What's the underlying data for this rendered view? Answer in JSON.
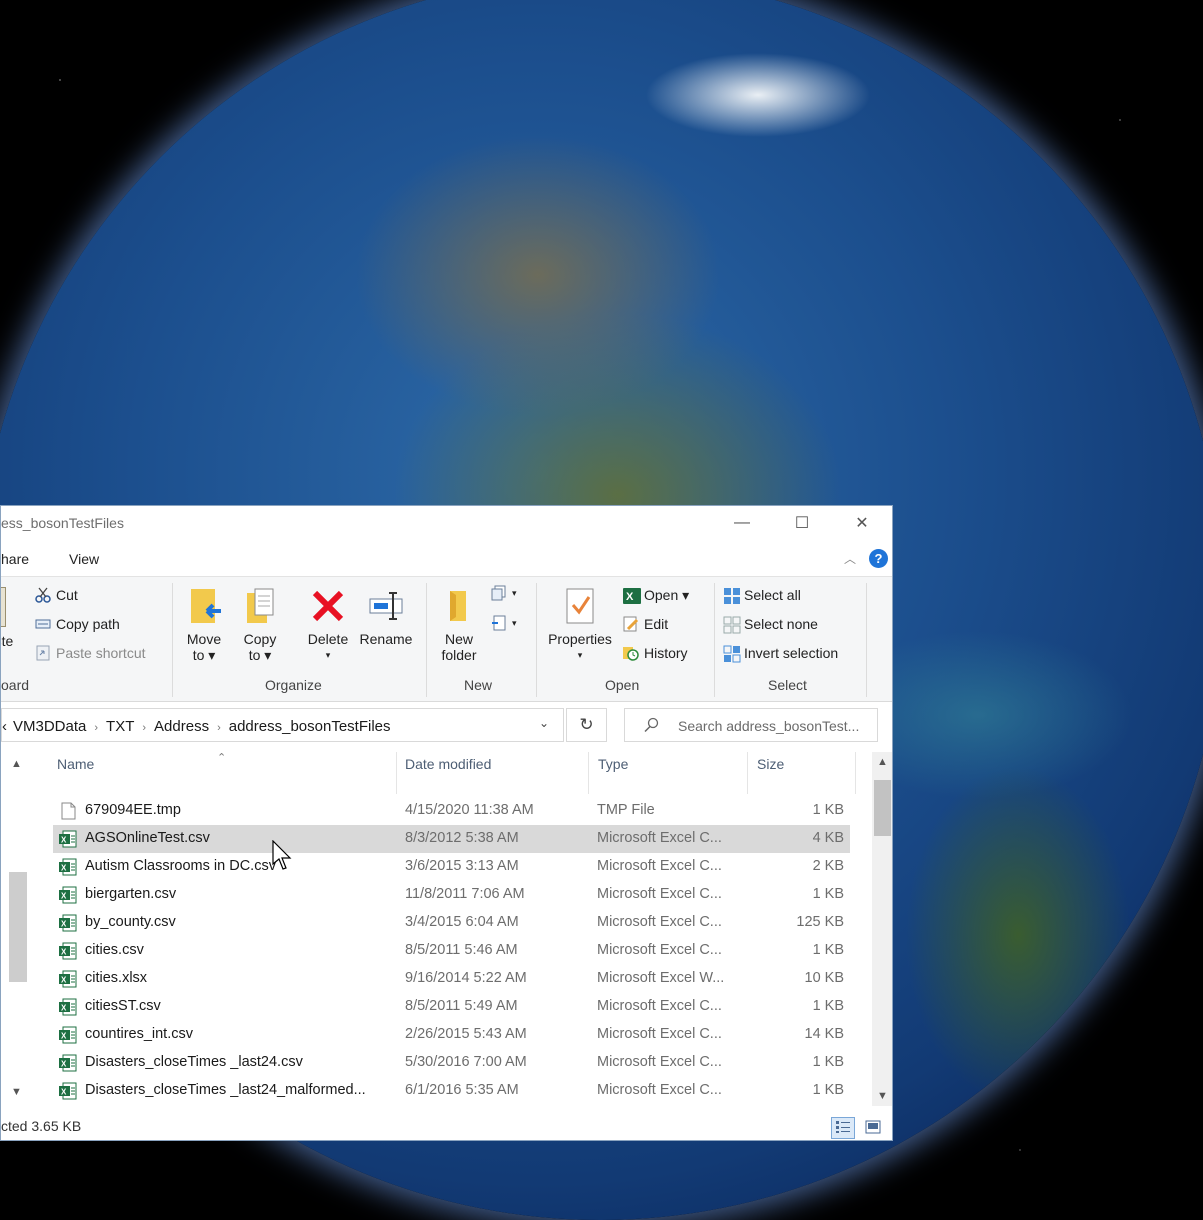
{
  "window": {
    "title": "ess_bosonTestFiles",
    "controls": {
      "minimize": "—",
      "maximize": "☐",
      "close": "✕"
    }
  },
  "menu": {
    "tab_share": "hare",
    "tab_view": "View",
    "help": "?"
  },
  "ribbon": {
    "clipboard": {
      "paste_label": "ste",
      "cut": "Cut",
      "copy_path": "Copy path",
      "paste_shortcut": "Paste shortcut",
      "group_label": "oard"
    },
    "organize": {
      "move_to_1": "Move",
      "move_to_2": "to ▾",
      "copy_to_1": "Copy",
      "copy_to_2": "to ▾",
      "delete": "Delete",
      "delete_arrow": "▾",
      "rename": "Rename",
      "group_label": "Organize"
    },
    "new": {
      "new_folder_1": "New",
      "new_folder_2": "folder",
      "group_label": "New"
    },
    "open": {
      "properties": "Properties",
      "properties_arrow": "▾",
      "open": "Open ▾",
      "edit": "Edit",
      "history": "History",
      "group_label": "Open"
    },
    "select": {
      "select_all": "Select all",
      "select_none": "Select none",
      "invert_selection": "Invert selection",
      "group_label": "Select"
    }
  },
  "address": {
    "crumb_0": "VM3DData",
    "crumb_1": "TXT",
    "crumb_2": "Address",
    "crumb_3": "address_bosonTestFiles",
    "lead": "‹"
  },
  "search": {
    "placeholder": "Search address_bosonTest..."
  },
  "columns": {
    "name": "Name",
    "date": "Date modified",
    "type": "Type",
    "size": "Size"
  },
  "files": [
    {
      "name": "679094EE.tmp",
      "date": "4/15/2020 11:38 AM",
      "type": "TMP File",
      "size": "1 KB",
      "icon": "file-icon"
    },
    {
      "name": "AGSOnlineTest.csv",
      "date": "8/3/2012 5:38 AM",
      "type": "Microsoft Excel C...",
      "size": "4 KB",
      "icon": "excel-icon",
      "selected": true
    },
    {
      "name": "Autism Classrooms in DC.csv",
      "date": "3/6/2015 3:13 AM",
      "type": "Microsoft Excel C...",
      "size": "2 KB",
      "icon": "excel-icon"
    },
    {
      "name": "biergarten.csv",
      "date": "11/8/2011 7:06 AM",
      "type": "Microsoft Excel C...",
      "size": "1 KB",
      "icon": "excel-icon"
    },
    {
      "name": "by_county.csv",
      "date": "3/4/2015 6:04 AM",
      "type": "Microsoft Excel C...",
      "size": "125 KB",
      "icon": "excel-icon"
    },
    {
      "name": "cities.csv",
      "date": "8/5/2011 5:46 AM",
      "type": "Microsoft Excel C...",
      "size": "1 KB",
      "icon": "excel-icon"
    },
    {
      "name": "cities.xlsx",
      "date": "9/16/2014 5:22 AM",
      "type": "Microsoft Excel W...",
      "size": "10 KB",
      "icon": "excel-icon"
    },
    {
      "name": "citiesST.csv",
      "date": "8/5/2011 5:49 AM",
      "type": "Microsoft Excel C...",
      "size": "1 KB",
      "icon": "excel-icon"
    },
    {
      "name": "countires_int.csv",
      "date": "2/26/2015 5:43 AM",
      "type": "Microsoft Excel C...",
      "size": "14 KB",
      "icon": "excel-icon"
    },
    {
      "name": "Disasters_closeTimes _last24.csv",
      "date": "5/30/2016 7:00 AM",
      "type": "Microsoft Excel C...",
      "size": "1 KB",
      "icon": "excel-icon"
    },
    {
      "name": "Disasters_closeTimes _last24_malformed...",
      "date": "6/1/2016 5:35 AM",
      "type": "Microsoft Excel C...",
      "size": "1 KB",
      "icon": "excel-icon"
    }
  ],
  "status": {
    "text": "cted  3.65 KB"
  },
  "colors": {
    "accent": "#1f74d8",
    "selection": "#d9d9d9",
    "excel_green": "#1d6f42",
    "delete_red": "#e81123"
  }
}
